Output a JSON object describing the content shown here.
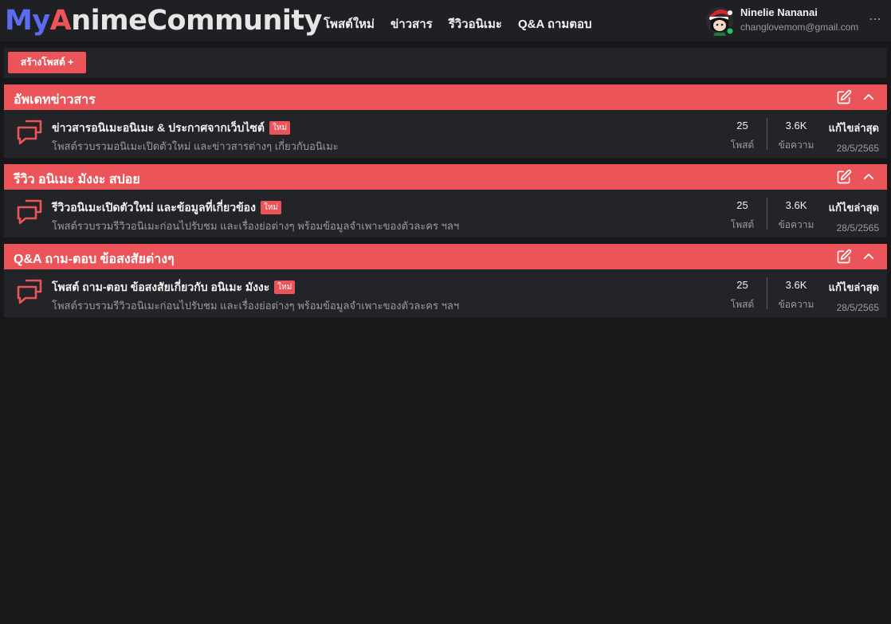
{
  "header": {
    "logo": {
      "part1": "My",
      "part2": "A",
      "part3": "nimeCommunity"
    },
    "nav": [
      "โพสต์ใหม่",
      "ข่าวสาร",
      "รีวิวอนิเมะ",
      "Q&A ถามตอบ"
    ],
    "user": {
      "name": "Ninelie Nananai",
      "email": "changlovemom@gmail.com",
      "online": true
    },
    "more_icon": "⋯"
  },
  "toolbar": {
    "create_label": "สร้างโพสต์ +"
  },
  "colors": {
    "accent": "#eb5459",
    "brand_blue": "#5b6cf0",
    "bg": "#18181b",
    "panel": "#232427"
  },
  "sections": [
    {
      "title": "อัพเดทข่าวสาร",
      "thread": {
        "title": "ข่าวสารอนิเมะอนิเมะ & ประกาศจากเว็บไซต์",
        "badge": "ใหม่",
        "description": "โพสต์รวบรวมอนิเมะเปิดตัวใหม่ และข่าวสารต่างๆ เกี่ยวกับอนิเมะ",
        "posts": "25",
        "posts_label": "โพสต์",
        "messages": "3.6K",
        "messages_label": "ข้อความ",
        "last_label": "แก้ไขล่าสุด",
        "last_date": "28/5/2565"
      }
    },
    {
      "title": "รีวิว อนิเมะ มังงะ สปอย",
      "thread": {
        "title": "รีวิวอนิเมะเปิดตัวใหม่ และข้อมูลที่เกี่ยวข้อง",
        "badge": "ใหม่",
        "description": "โพสต์รวบรวมรีวิวอนิเมะก่อนไปรับชม และเรื่องย่อต่างๆ พร้อมข้อมูลจำเพาะของตัวละคร ฯลฯ",
        "posts": "25",
        "posts_label": "โพสต์",
        "messages": "3.6K",
        "messages_label": "ข้อความ",
        "last_label": "แก้ไขล่าสุด",
        "last_date": "28/5/2565"
      }
    },
    {
      "title": "Q&A ถาม-ตอบ ข้อสงสัยต่างๆ",
      "thread": {
        "title": "โพสต์ ถาม-ตอบ ข้อสงสัยเกี่ยวกับ อนิเมะ มังงะ",
        "badge": "ใหม่",
        "description": "โพสต์รวบรวมรีวิวอนิเมะก่อนไปรับชม และเรื่องย่อต่างๆ พร้อมข้อมูลจำเพาะของตัวละคร ฯลฯ",
        "posts": "25",
        "posts_label": "โพสต์",
        "messages": "3.6K",
        "messages_label": "ข้อความ",
        "last_label": "แก้ไขล่าสุด",
        "last_date": "28/5/2565"
      }
    }
  ]
}
